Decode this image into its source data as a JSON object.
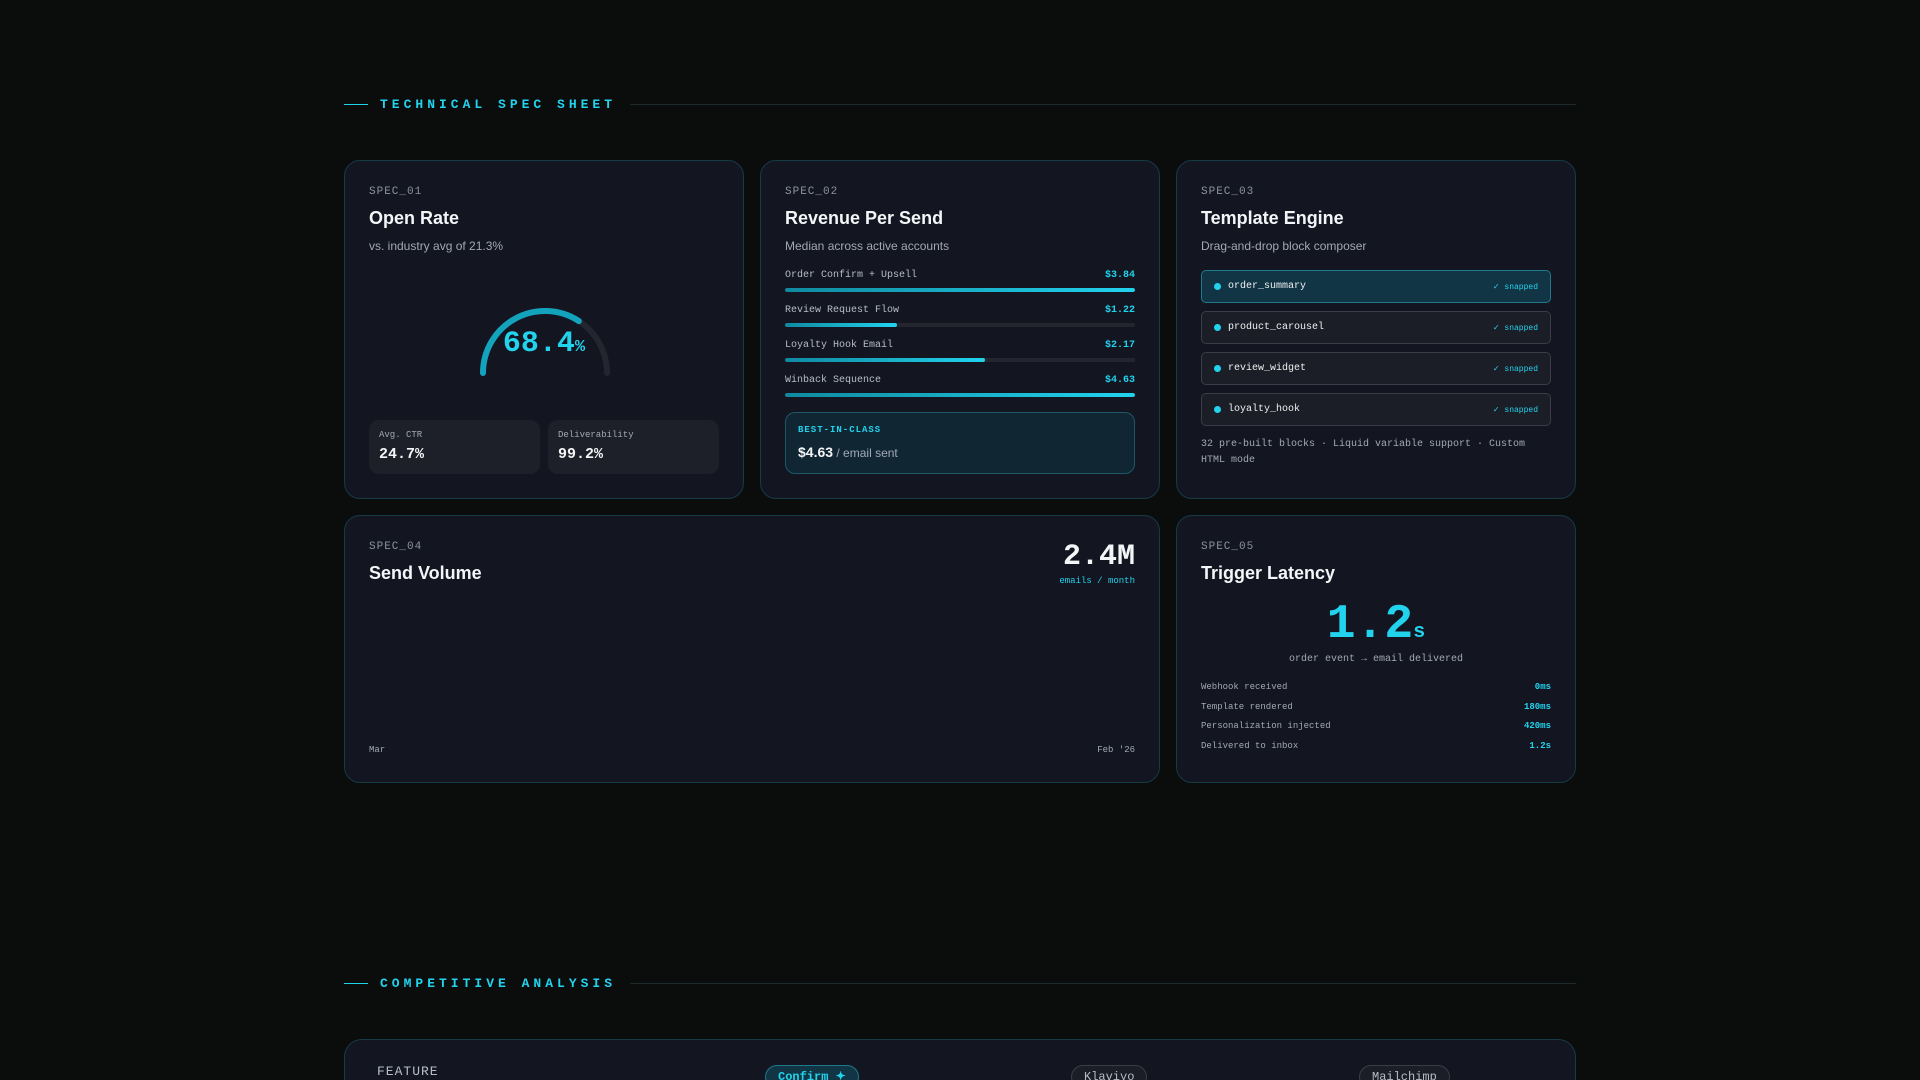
{
  "sections": {
    "spec_title": "TECHNICAL SPEC SHEET",
    "comp_title": "COMPETITIVE ANALYSIS"
  },
  "spec01": {
    "id": "SPEC_01",
    "title": "Open Rate",
    "subtitle": "vs. industry avg of 21.3%",
    "value": "68.4",
    "unit": "%",
    "gauge_fraction": 0.684,
    "stats": [
      {
        "label": "Avg. CTR",
        "value": "24.7%"
      },
      {
        "label": "Deliverability",
        "value": "99.2%"
      }
    ]
  },
  "spec02": {
    "id": "SPEC_02",
    "title": "Revenue Per Send",
    "subtitle": "Median across active accounts",
    "rows": [
      {
        "name": "Order Confirm + Upsell",
        "amount": "$3.84",
        "fraction": 1.0
      },
      {
        "name": "Review Request Flow",
        "amount": "$1.22",
        "fraction": 0.32
      },
      {
        "name": "Loyalty Hook Email",
        "amount": "$2.17",
        "fraction": 0.57
      },
      {
        "name": "Winback Sequence",
        "amount": "$4.63",
        "fraction": 1.0
      }
    ],
    "best": {
      "tag": "BEST-IN-CLASS",
      "value": "$4.63",
      "suffix": "/ email sent"
    }
  },
  "spec03": {
    "id": "SPEC_03",
    "title": "Template Engine",
    "subtitle": "Drag-and-drop block composer",
    "blocks": [
      {
        "name": "order_summary",
        "status": "✓ snapped"
      },
      {
        "name": "product_carousel",
        "status": "✓ snapped"
      },
      {
        "name": "review_widget",
        "status": "✓ snapped"
      },
      {
        "name": "loyalty_hook",
        "status": "✓ snapped"
      }
    ],
    "footer": "32 pre-built blocks · Liquid variable support · Custom HTML mode"
  },
  "spec04": {
    "id": "SPEC_04",
    "title": "Send Volume",
    "value": "2.4M",
    "unit": "emails / month",
    "axis_start": "Mar",
    "axis_end": "Feb '26"
  },
  "spec05": {
    "id": "SPEC_05",
    "title": "Trigger Latency",
    "value": "1.2",
    "unit": "s",
    "caption": "order event → email delivered",
    "rows": [
      {
        "label": "Webhook received",
        "value": "0ms"
      },
      {
        "label": "Template rendered",
        "value": "180ms"
      },
      {
        "label": "Personalization injected",
        "value": "420ms"
      },
      {
        "label": "Delivered to inbox",
        "value": "1.2s"
      }
    ]
  },
  "comparison": {
    "feature_label": "FEATURE",
    "columns": [
      "Confirm ✦",
      "Klaviyo",
      "Mailchimp"
    ]
  },
  "colors": {
    "accent": "#22d3ee",
    "background": "#0b0c0c",
    "card": "#131520"
  }
}
